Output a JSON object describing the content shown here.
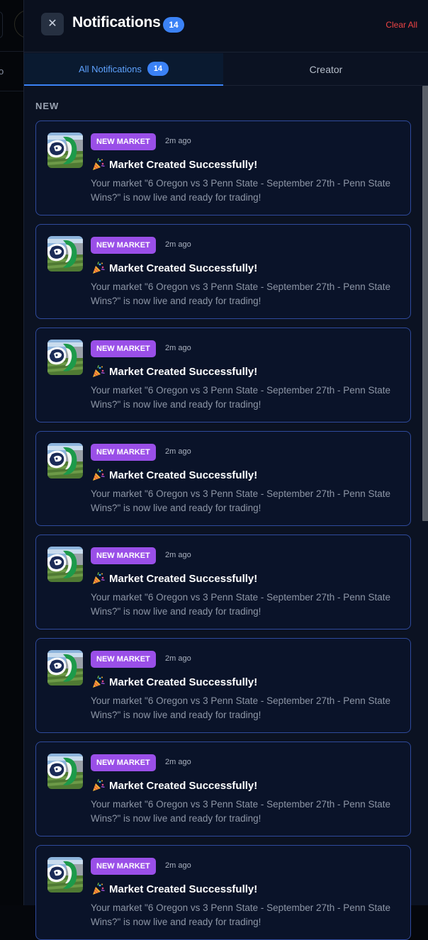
{
  "header": {
    "title": "Notifications",
    "count": "14",
    "close_glyph": "✕",
    "clear_all": "Clear All"
  },
  "tabs": [
    {
      "label": "All Notifications",
      "count": "14",
      "active": true
    },
    {
      "label": "Creator",
      "active": false
    }
  ],
  "section": {
    "label": "NEW"
  },
  "notifications": [
    {
      "badge": "NEW MARKET",
      "time": "2m ago",
      "title": "Market Created Successfully!",
      "body": "Your market \"6 Oregon vs 3 Penn State - September 27th - Penn State Wins?\" is now live and ready for trading!"
    },
    {
      "badge": "NEW MARKET",
      "time": "2m ago",
      "title": "Market Created Successfully!",
      "body": "Your market \"6 Oregon vs 3 Penn State - September 27th - Penn State Wins?\" is now live and ready for trading!"
    },
    {
      "badge": "NEW MARKET",
      "time": "2m ago",
      "title": "Market Created Successfully!",
      "body": "Your market \"6 Oregon vs 3 Penn State - September 27th - Penn State Wins?\" is now live and ready for trading!"
    },
    {
      "badge": "NEW MARKET",
      "time": "2m ago",
      "title": "Market Created Successfully!",
      "body": "Your market \"6 Oregon vs 3 Penn State - September 27th - Penn State Wins?\" is now live and ready for trading!"
    },
    {
      "badge": "NEW MARKET",
      "time": "2m ago",
      "title": "Market Created Successfully!",
      "body": "Your market \"6 Oregon vs 3 Penn State - September 27th - Penn State Wins?\" is now live and ready for trading!"
    },
    {
      "badge": "NEW MARKET",
      "time": "2m ago",
      "title": "Market Created Successfully!",
      "body": "Your market \"6 Oregon vs 3 Penn State - September 27th - Penn State Wins?\" is now live and ready for trading!"
    },
    {
      "badge": "NEW MARKET",
      "time": "2m ago",
      "title": "Market Created Successfully!",
      "body": "Your market \"6 Oregon vs 3 Penn State - September 27th - Penn State Wins?\" is now live and ready for trading!"
    },
    {
      "badge": "NEW MARKET",
      "time": "2m ago",
      "title": "Market Created Successfully!",
      "body": "Your market \"6 Oregon vs 3 Penn State - September 27th - Penn State Wins?\" is now live and ready for trading!"
    }
  ],
  "icons": {
    "close": "close-icon",
    "party": "party-popper-icon",
    "thumbnail": "penn-state-oregon-thumbnail"
  },
  "colors": {
    "accent": "#3b82f6",
    "badge": "#9a4fe8",
    "clear_all": "#ef4444",
    "card_border": "#2f4a9c"
  }
}
